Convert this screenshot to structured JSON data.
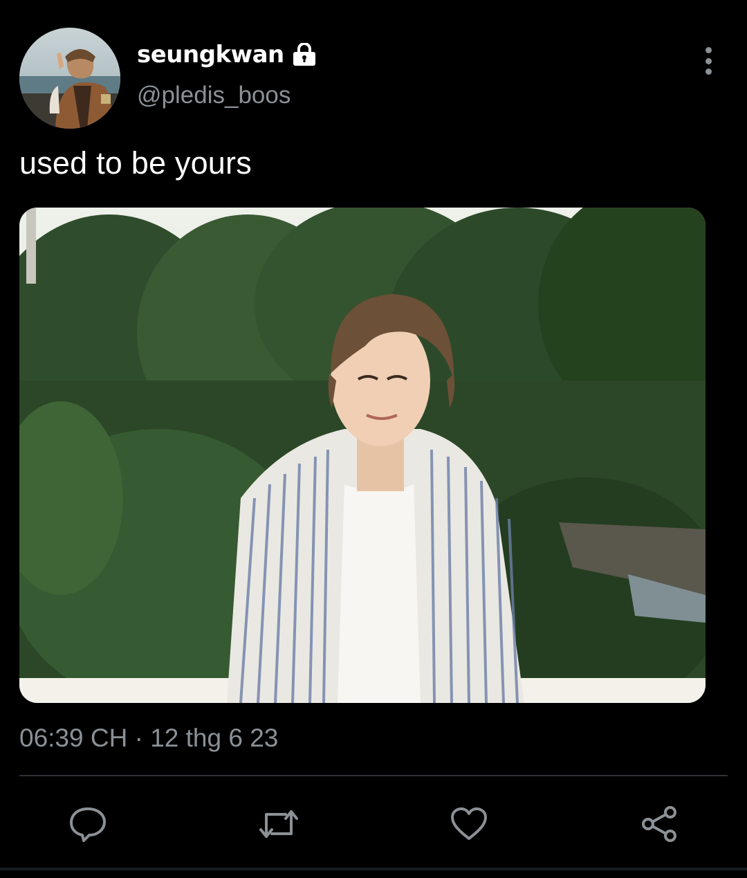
{
  "author": {
    "display_name": "seungkwan",
    "handle": "@pledis_boos",
    "protected_icon": "lock-icon",
    "avatar_alt": "avatar"
  },
  "tweet": {
    "text": "used to be yours",
    "timestamp": "06:39 CH · 12 thg 6 23"
  },
  "actions": [
    {
      "name": "reply",
      "icon": "speech-bubble-icon"
    },
    {
      "name": "retweet",
      "icon": "retweet-icon"
    },
    {
      "name": "like",
      "icon": "heart-icon"
    },
    {
      "name": "share",
      "icon": "share-icon"
    }
  ],
  "colors": {
    "background": "#000000",
    "text_primary": "#ffffff",
    "text_secondary": "#8b9196",
    "divider": "#2f3336",
    "icon": "#8b9196"
  }
}
